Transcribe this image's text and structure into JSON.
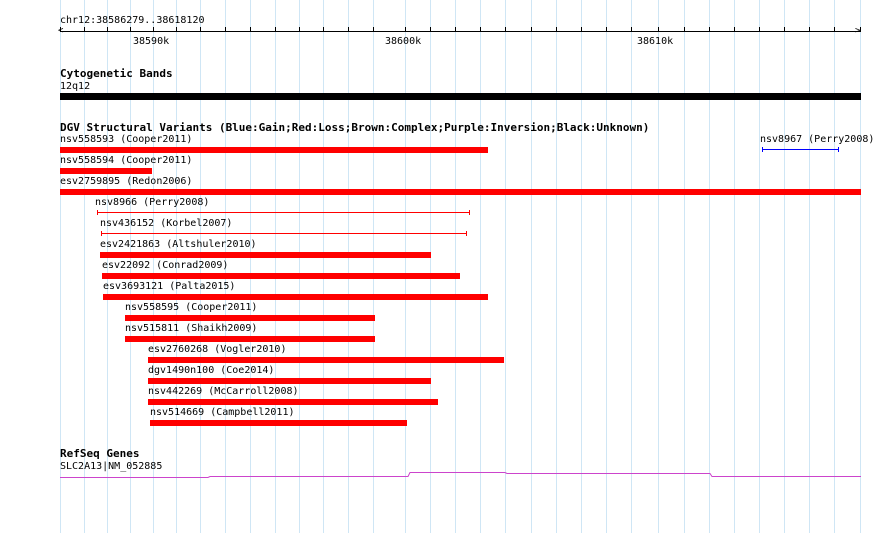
{
  "ruler": {
    "location": "chr12:38586279..38618120",
    "ticks": [
      "38590k",
      "38600k",
      "38610k"
    ]
  },
  "cytoband": {
    "title": "Cytogenetic Bands",
    "band": "12q12",
    "color": "#000000"
  },
  "dgv": {
    "title": "DGV Structural Variants (Blue:Gain;Red:Loss;Brown:Complex;Purple:Inversion;Black:Unknown)",
    "loss_color": "#ff0000",
    "gain_color": "#0000ff",
    "variants": [
      {
        "label": "nsv558593 (Cooper2011)",
        "type": "loss",
        "style": "bar"
      },
      {
        "label": "nsv8967 (Perry2008)",
        "type": "gain",
        "style": "line"
      },
      {
        "label": "nsv558594 (Cooper2011)",
        "type": "loss",
        "style": "bar"
      },
      {
        "label": "esv2759895 (Redon2006)",
        "type": "loss",
        "style": "bar"
      },
      {
        "label": "nsv8966 (Perry2008)",
        "type": "loss",
        "style": "line"
      },
      {
        "label": "nsv436152 (Korbel2007)",
        "type": "loss",
        "style": "line"
      },
      {
        "label": "esv2421863 (Altshuler2010)",
        "type": "loss",
        "style": "bar"
      },
      {
        "label": "esv22092 (Conrad2009)",
        "type": "loss",
        "style": "bar"
      },
      {
        "label": "esv3693121 (Palta2015)",
        "type": "loss",
        "style": "bar"
      },
      {
        "label": "nsv558595 (Cooper2011)",
        "type": "loss",
        "style": "bar"
      },
      {
        "label": "nsv515811 (Shaikh2009)",
        "type": "loss",
        "style": "bar"
      },
      {
        "label": "esv2760268 (Vogler2010)",
        "type": "loss",
        "style": "bar"
      },
      {
        "label": "dgv1490n100 (Coe2014)",
        "type": "loss",
        "style": "bar"
      },
      {
        "label": "nsv442269 (McCarroll2008)",
        "type": "loss",
        "style": "bar"
      },
      {
        "label": "nsv514669 (Campbell2011)",
        "type": "loss",
        "style": "bar"
      }
    ]
  },
  "refseq": {
    "title": "RefSeq Genes",
    "gene": "SLC2A13|NM_052885",
    "color": "#cc44cc"
  }
}
